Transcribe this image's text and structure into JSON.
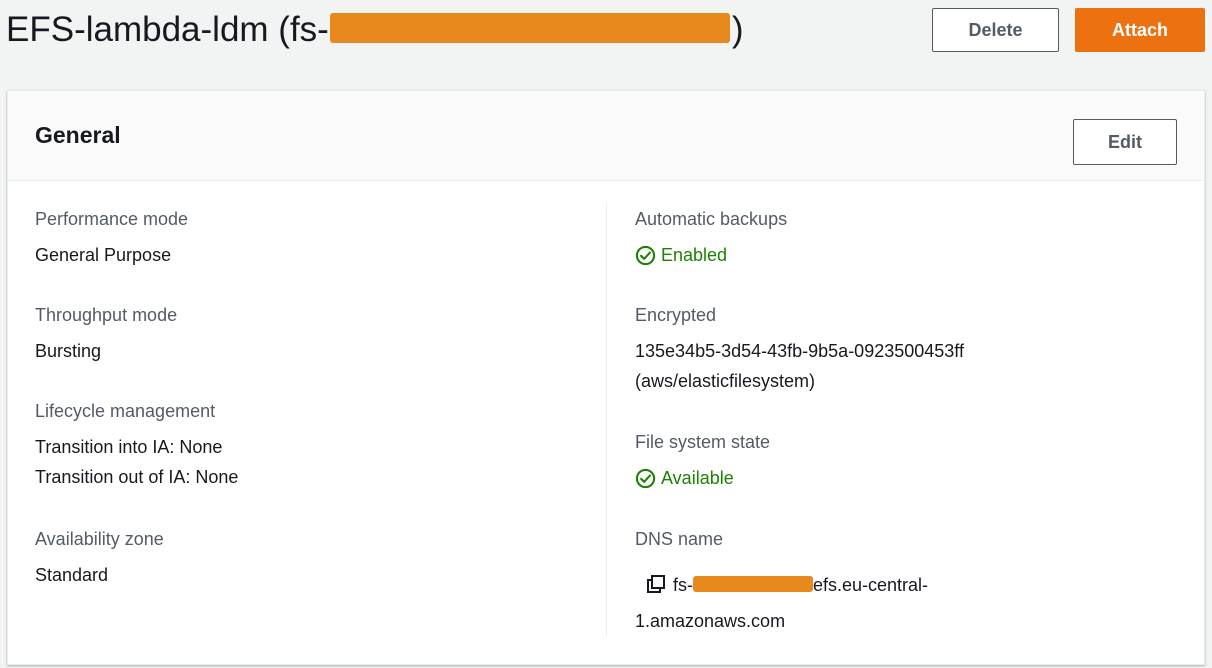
{
  "header": {
    "title_prefix": "EFS-lambda-ldm (fs-",
    "title_suffix": ")",
    "delete_label": "Delete",
    "attach_label": "Attach"
  },
  "general": {
    "title": "General",
    "edit_label": "Edit",
    "left": [
      {
        "label": "Performance mode",
        "value": "General Purpose"
      },
      {
        "label": "Throughput mode",
        "value": "Bursting"
      },
      {
        "label": "Lifecycle management",
        "value_line1": "Transition into IA: None",
        "value_line2": "Transition out of IA: None"
      },
      {
        "label": "Availability zone",
        "value": "Standard"
      }
    ],
    "right": {
      "backups": {
        "label": "Automatic backups",
        "status": "Enabled"
      },
      "encrypted": {
        "label": "Encrypted",
        "key_id": "135e34b5-3d54-43fb-9b5a-0923500453ff",
        "alias": "(aws/elasticfilesystem)"
      },
      "state": {
        "label": "File system state",
        "status": "Available"
      },
      "dns": {
        "label": "DNS name",
        "prefix": "fs-",
        "suffix_line1": "efs.eu-central-",
        "suffix_line2": "1.amazonaws.com"
      }
    }
  },
  "colors": {
    "primary": "#ec7211",
    "success": "#1d8102",
    "redaction": "#e8891d"
  }
}
